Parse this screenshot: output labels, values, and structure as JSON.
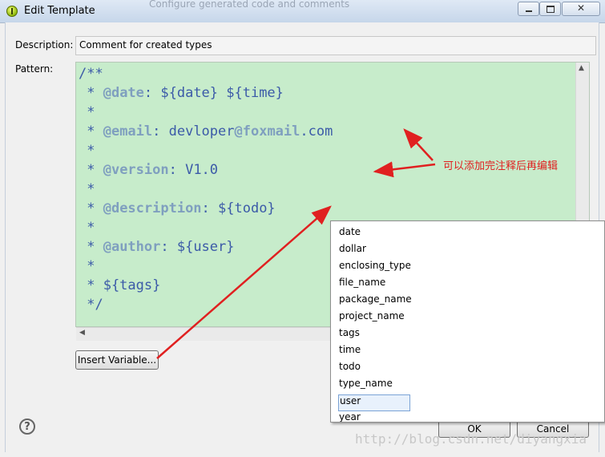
{
  "window": {
    "title": "Edit Template",
    "background_title": "Configure generated code and comments"
  },
  "form": {
    "description_label": "Description:",
    "description_value": "Comment for created types",
    "pattern_label": "Pattern:"
  },
  "pattern": {
    "code_text": "/**\n * @date: ${date} ${time}\n *\n * @email: devloper@foxmail.com\n *\n * @version: V1.0\n *\n * @description: ${todo}\n *\n * @author: ${user}\n *\n * ${tags}\n */"
  },
  "buttons": {
    "insert_variable": "Insert Variable...",
    "ok": "OK",
    "cancel": "Cancel",
    "help": "?"
  },
  "variables": [
    "date",
    "dollar",
    "enclosing_type",
    "file_name",
    "package_name",
    "project_name",
    "tags",
    "time",
    "todo",
    "type_name",
    "user",
    "year"
  ],
  "selected_variable": "user",
  "annotation": {
    "note": "可以添加完注释后再编辑"
  },
  "watermark": "http://blog.csdn.net/diyangxia",
  "colors": {
    "editor_bg": "#c7eccb",
    "code_text": "#3b5aa8",
    "annotation_red": "#e02020"
  }
}
